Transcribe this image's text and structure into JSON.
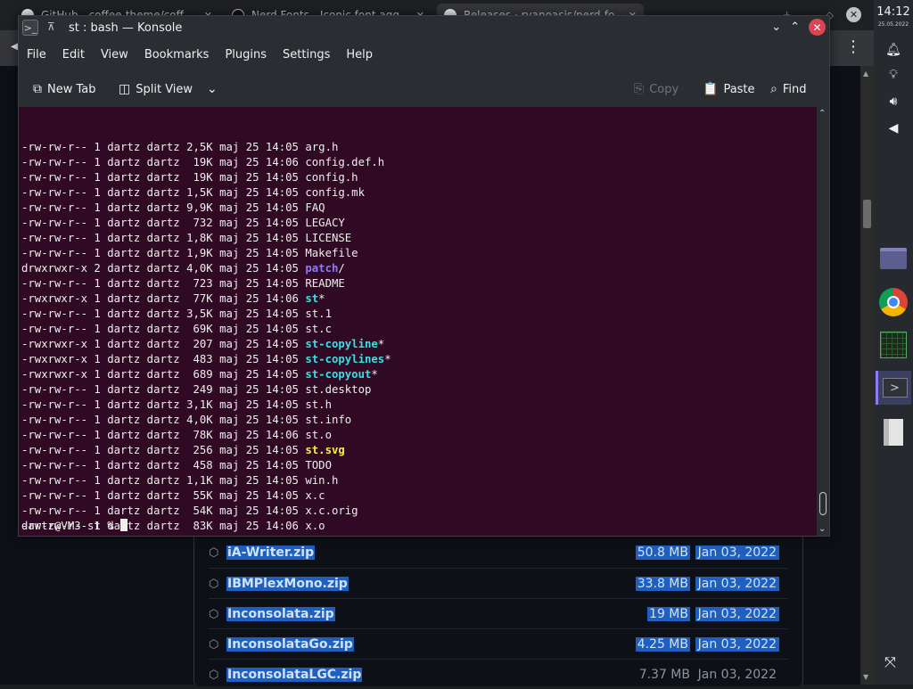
{
  "browser": {
    "tabs": [
      {
        "label": "GitHub - coffee-theme/coff",
        "close": "✕"
      },
      {
        "label": "Nerd Fonts - Iconic font agg",
        "close": "✕"
      },
      {
        "label": "Releases · ryanoasis/nerd-fo",
        "close": "✕"
      },
      {
        "label": "",
        "close": ""
      }
    ],
    "new_tab": "+",
    "menu_icon": "⋮",
    "assets": [
      {
        "name": "iA-Writer.zip",
        "size": "50.8 MB",
        "date": "Jan 03, 2022"
      },
      {
        "name": "IBMPlexMono.zip",
        "size": "33.8 MB",
        "date": "Jan 03, 2022"
      },
      {
        "name": "Inconsolata.zip",
        "size": "19 MB",
        "date": "Jan 03, 2022"
      },
      {
        "name": "InconsolataGo.zip",
        "size": "4.25 MB",
        "date": "Jan 03, 2022"
      },
      {
        "name": "InconsolataLGC.zip",
        "size": "7.37 MB",
        "date": "Jan 03, 2022"
      }
    ]
  },
  "konsole": {
    "title": "st : bash — Konsole",
    "menu": [
      "File",
      "Edit",
      "View",
      "Bookmarks",
      "Plugins",
      "Settings",
      "Help"
    ],
    "toolbar": {
      "new_tab": "New Tab",
      "split_view": "Split View",
      "copy": "Copy",
      "paste": "Paste",
      "find": "Find"
    },
    "listing": [
      {
        "meta": "-rw-rw-r-- 1 dartz dartz 2,5K maj 25 14:05 ",
        "name": "arg.h",
        "kind": "file"
      },
      {
        "meta": "-rw-rw-r-- 1 dartz dartz  19K maj 25 14:06 ",
        "name": "config.def.h",
        "kind": "file"
      },
      {
        "meta": "-rw-rw-r-- 1 dartz dartz  19K maj 25 14:05 ",
        "name": "config.h",
        "kind": "file"
      },
      {
        "meta": "-rw-rw-r-- 1 dartz dartz 1,5K maj 25 14:05 ",
        "name": "config.mk",
        "kind": "file"
      },
      {
        "meta": "-rw-rw-r-- 1 dartz dartz 9,9K maj 25 14:05 ",
        "name": "FAQ",
        "kind": "file"
      },
      {
        "meta": "-rw-rw-r-- 1 dartz dartz  732 maj 25 14:05 ",
        "name": "LEGACY",
        "kind": "file"
      },
      {
        "meta": "-rw-rw-r-- 1 dartz dartz 1,8K maj 25 14:05 ",
        "name": "LICENSE",
        "kind": "file"
      },
      {
        "meta": "-rw-rw-r-- 1 dartz dartz 1,9K maj 25 14:05 ",
        "name": "Makefile",
        "kind": "file"
      },
      {
        "meta": "drwxrwxr-x 2 dartz dartz 4,0K maj 25 14:05 ",
        "name": "patch",
        "kind": "dir",
        "suffix": "/"
      },
      {
        "meta": "-rw-rw-r-- 1 dartz dartz  723 maj 25 14:05 ",
        "name": "README",
        "kind": "file"
      },
      {
        "meta": "-rwxrwxr-x 1 dartz dartz  77K maj 25 14:06 ",
        "name": "st",
        "kind": "exe",
        "suffix": "*"
      },
      {
        "meta": "-rw-rw-r-- 1 dartz dartz 3,5K maj 25 14:05 ",
        "name": "st.1",
        "kind": "file"
      },
      {
        "meta": "-rw-rw-r-- 1 dartz dartz  69K maj 25 14:05 ",
        "name": "st.c",
        "kind": "file"
      },
      {
        "meta": "-rwxrwxr-x 1 dartz dartz  207 maj 25 14:05 ",
        "name": "st-copyline",
        "kind": "exe",
        "suffix": "*"
      },
      {
        "meta": "-rwxrwxr-x 1 dartz dartz  483 maj 25 14:05 ",
        "name": "st-copylines",
        "kind": "exe",
        "suffix": "*"
      },
      {
        "meta": "-rwxrwxr-x 1 dartz dartz  689 maj 25 14:05 ",
        "name": "st-copyout",
        "kind": "exe",
        "suffix": "*"
      },
      {
        "meta": "-rw-rw-r-- 1 dartz dartz  249 maj 25 14:05 ",
        "name": "st.desktop",
        "kind": "file"
      },
      {
        "meta": "-rw-rw-r-- 1 dartz dartz 3,1K maj 25 14:05 ",
        "name": "st.h",
        "kind": "file"
      },
      {
        "meta": "-rw-rw-r-- 1 dartz dartz 4,0K maj 25 14:05 ",
        "name": "st.info",
        "kind": "file"
      },
      {
        "meta": "-rw-rw-r-- 1 dartz dartz  78K maj 25 14:06 ",
        "name": "st.o",
        "kind": "file"
      },
      {
        "meta": "-rw-rw-r-- 1 dartz dartz  256 maj 25 14:05 ",
        "name": "st.svg",
        "kind": "img"
      },
      {
        "meta": "-rw-rw-r-- 1 dartz dartz  458 maj 25 14:05 ",
        "name": "TODO",
        "kind": "file"
      },
      {
        "meta": "-rw-rw-r-- 1 dartz dartz 1,1K maj 25 14:05 ",
        "name": "win.h",
        "kind": "file"
      },
      {
        "meta": "-rw-rw-r-- 1 dartz dartz  55K maj 25 14:05 ",
        "name": "x.c",
        "kind": "file"
      },
      {
        "meta": "-rw-rw-r-- 1 dartz dartz  54K maj 25 14:05 ",
        "name": "x.c.orig",
        "kind": "file"
      },
      {
        "meta": "-rw-rw-r-- 1 dartz dartz  83K maj 25 14:06 ",
        "name": "x.o",
        "kind": "file"
      }
    ],
    "prompt": "dartz@VM3 st % "
  },
  "panel": {
    "time": "14:12",
    "date": "25.05.2022",
    "tasks": [
      "folder-icon",
      "chrome-icon",
      "system-monitor-icon",
      "konsole-icon",
      "archive-icon"
    ]
  },
  "colors": {
    "terminal_bg": "#300a24",
    "dir": "#8b7cf6",
    "exe": "#34e2e2",
    "img": "#fce94f",
    "close": "#da4453",
    "selection": "#1f5fbf"
  }
}
